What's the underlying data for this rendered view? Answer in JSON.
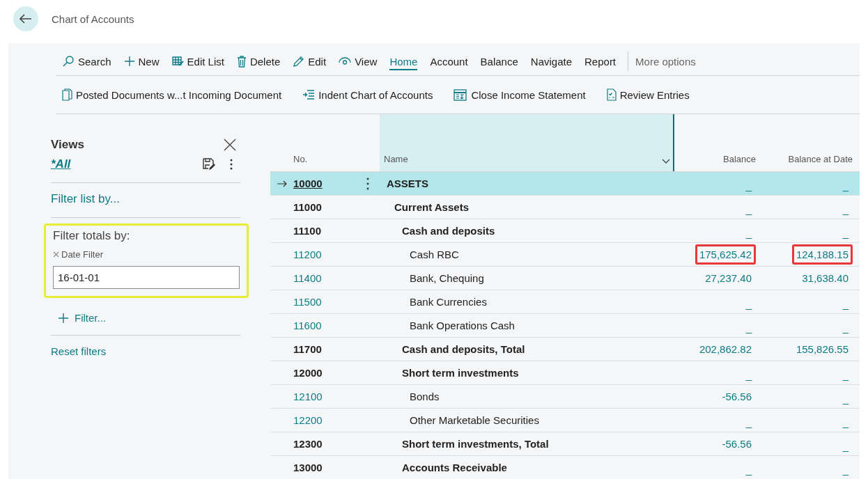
{
  "page": {
    "title": "Chart of Accounts"
  },
  "actions": [
    {
      "label": "Search",
      "selected": false
    },
    {
      "label": "New",
      "selected": false
    },
    {
      "label": "Edit List",
      "selected": false
    },
    {
      "label": "Delete",
      "selected": false
    },
    {
      "label": "Edit",
      "selected": false
    },
    {
      "label": "View",
      "selected": false
    },
    {
      "label": "Home",
      "selected": true
    },
    {
      "label": "Account",
      "selected": false
    },
    {
      "label": "Balance",
      "selected": false
    },
    {
      "label": "Navigate",
      "selected": false
    },
    {
      "label": "Report",
      "selected": false
    }
  ],
  "more_options": "More options",
  "home_actions": [
    "Posted Documents w...t Incoming Document",
    "Indent Chart of Accounts",
    "Close Income Statement",
    "Review Entries"
  ],
  "views": {
    "title": "Views",
    "current": "*All",
    "filter_list": "Filter list by...",
    "filter_totals": "Filter totals by:",
    "date_filter_label": "Date Filter",
    "date_filter_value": "16-01-01",
    "add_filter": "Filter...",
    "reset": "Reset filters"
  },
  "table": {
    "columns": [
      "No.",
      "Name",
      "Balance",
      "Balance at Date"
    ],
    "rows": [
      {
        "no": "10000",
        "name": "ASSETS",
        "kind": "heading",
        "balance": "_",
        "balance_at_date": "_",
        "selected": true,
        "boxed": false,
        "children": [
          {
            "no": "11000",
            "name": "Current Assets",
            "kind": "heading",
            "balance": "_",
            "balance_at_date": "_",
            "selected": false,
            "boxed": false,
            "children": [
              {
                "no": "11100",
                "name": "Cash and deposits",
                "kind": "heading",
                "balance": "_",
                "balance_at_date": "_",
                "selected": false,
                "boxed": false,
                "children": [
                  {
                    "no": "11200",
                    "name": "Cash RBC",
                    "kind": "posting",
                    "balance": "175,625.42",
                    "balance_at_date": "124,188.15",
                    "selected": false,
                    "boxed": true
                  },
                  {
                    "no": "11400",
                    "name": "Bank, Chequing",
                    "kind": "posting",
                    "balance": "27,237.40",
                    "balance_at_date": "31,638.40",
                    "selected": false,
                    "boxed": false
                  },
                  {
                    "no": "11500",
                    "name": "Bank Currencies",
                    "kind": "posting",
                    "balance": "_",
                    "balance_at_date": "_",
                    "selected": false,
                    "boxed": false
                  },
                  {
                    "no": "11600",
                    "name": "Bank Operations Cash",
                    "kind": "posting",
                    "balance": "_",
                    "balance_at_date": "_",
                    "selected": false,
                    "boxed": false
                  }
                ]
              },
              {
                "no": "11700",
                "name": "Cash and deposits, Total",
                "kind": "heading",
                "balance": "202,862.82",
                "balance_at_date": "155,826.55",
                "selected": false,
                "boxed": false
              },
              {
                "no": "12000",
                "name": "Short term investments",
                "kind": "heading",
                "balance": "_",
                "balance_at_date": "_",
                "selected": false,
                "boxed": false,
                "children": [
                  {
                    "no": "12100",
                    "name": "Bonds",
                    "kind": "posting",
                    "balance": "-56.56",
                    "balance_at_date": "_",
                    "selected": false,
                    "boxed": false
                  },
                  {
                    "no": "12200",
                    "name": "Other Marketable Securities",
                    "kind": "posting",
                    "balance": "_",
                    "balance_at_date": "_",
                    "selected": false,
                    "boxed": false
                  }
                ]
              },
              {
                "no": "12300",
                "name": "Short term investments, Total",
                "kind": "heading",
                "balance": "-56.56",
                "balance_at_date": "_",
                "selected": false,
                "boxed": false
              },
              {
                "no": "13000",
                "name": "Accounts Receivable",
                "kind": "heading",
                "balance": "_",
                "balance_at_date": "_",
                "selected": false,
                "boxed": false
              }
            ]
          }
        ]
      }
    ]
  }
}
